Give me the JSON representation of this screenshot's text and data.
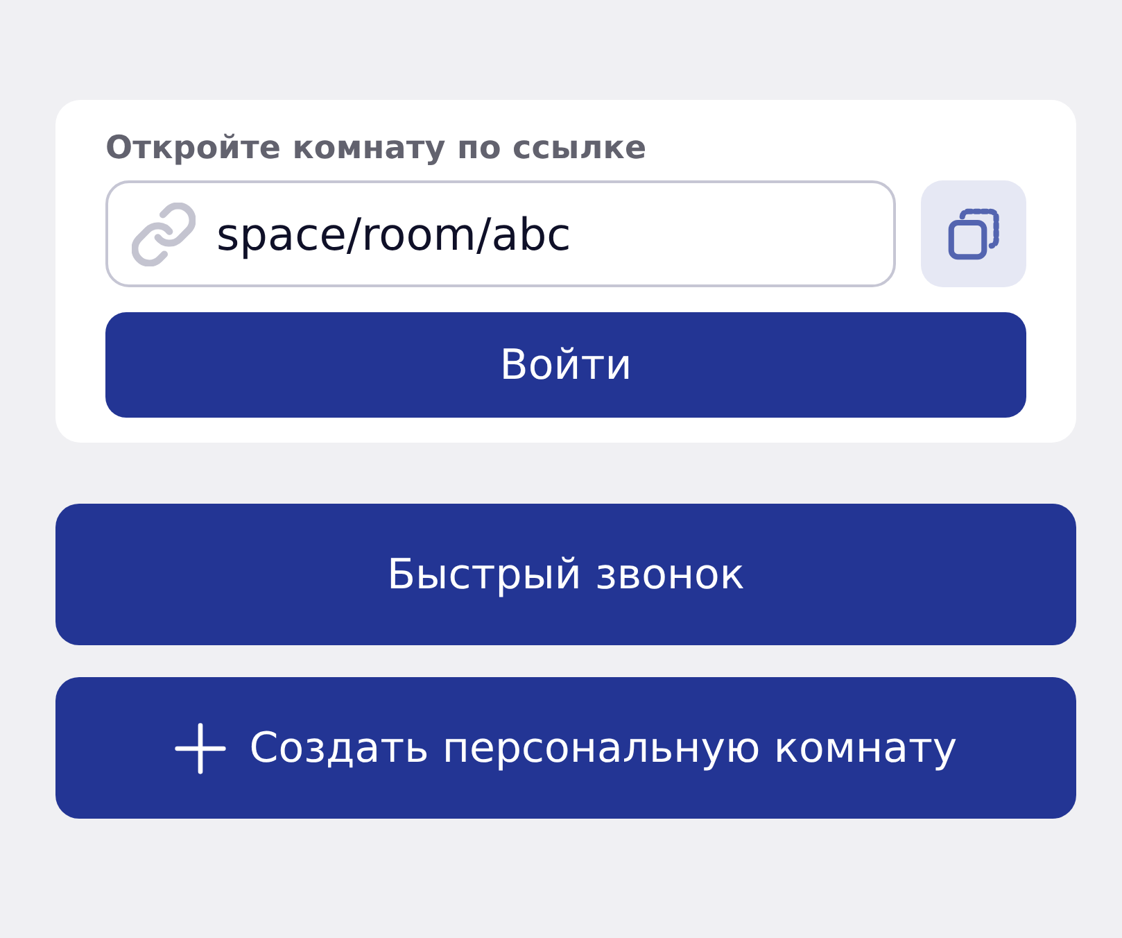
{
  "link_form": {
    "label": "Откройте комнату по ссылке",
    "input": {
      "value": "space/room/abc"
    },
    "join_button": "Войти"
  },
  "actions": [
    {
      "kind": "quick",
      "label": "Быстрый звонок"
    },
    {
      "kind": "create",
      "label": "Создать персональную комнату"
    }
  ]
}
